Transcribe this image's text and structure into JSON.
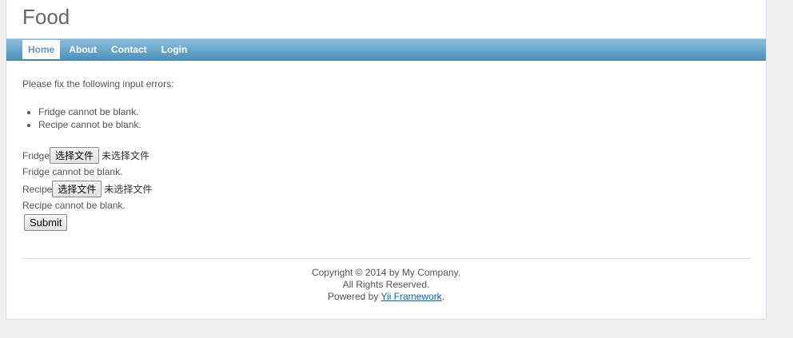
{
  "header": {
    "title": "Food"
  },
  "menu": {
    "items": [
      {
        "label": "Home",
        "active": true
      },
      {
        "label": "About"
      },
      {
        "label": "Contact"
      },
      {
        "label": "Login"
      }
    ]
  },
  "form": {
    "error_summary": {
      "intro": "Please fix the following input errors:",
      "errors": [
        "Fridge cannot be blank.",
        "Recipe cannot be blank."
      ]
    },
    "fields": [
      {
        "label": "Fridge",
        "button": "选择文件",
        "status": "未选择文件",
        "error": "Fridge cannot be blank."
      },
      {
        "label": "Recipe",
        "button": "选择文件",
        "status": "未选择文件",
        "error": "Recipe cannot be blank."
      }
    ],
    "submit_label": "Submit"
  },
  "footer": {
    "copyright": "Copyright © 2014 by My Company.",
    "rights": "All Rights Reserved.",
    "powered_prefix": "Powered by ",
    "powered_link": "Yii Framework",
    "powered_suffix": "."
  }
}
